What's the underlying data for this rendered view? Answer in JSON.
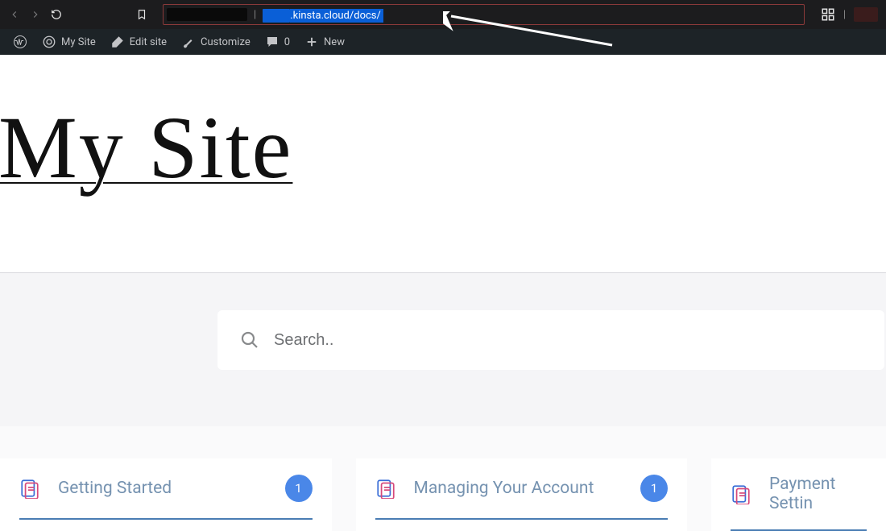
{
  "browser": {
    "url_visible": ".kinsta.cloud/docs/"
  },
  "adminBar": {
    "mySite": "My Site",
    "editSite": "Edit site",
    "customize": "Customize",
    "commentCount": "0",
    "new": "New"
  },
  "page": {
    "title": "My Site",
    "search": {
      "placeholder": "Search.."
    }
  },
  "cards": [
    {
      "title": "Getting Started",
      "count": "1"
    },
    {
      "title": "Managing Your Account",
      "count": "1"
    },
    {
      "title": "Payment Settin"
    }
  ]
}
